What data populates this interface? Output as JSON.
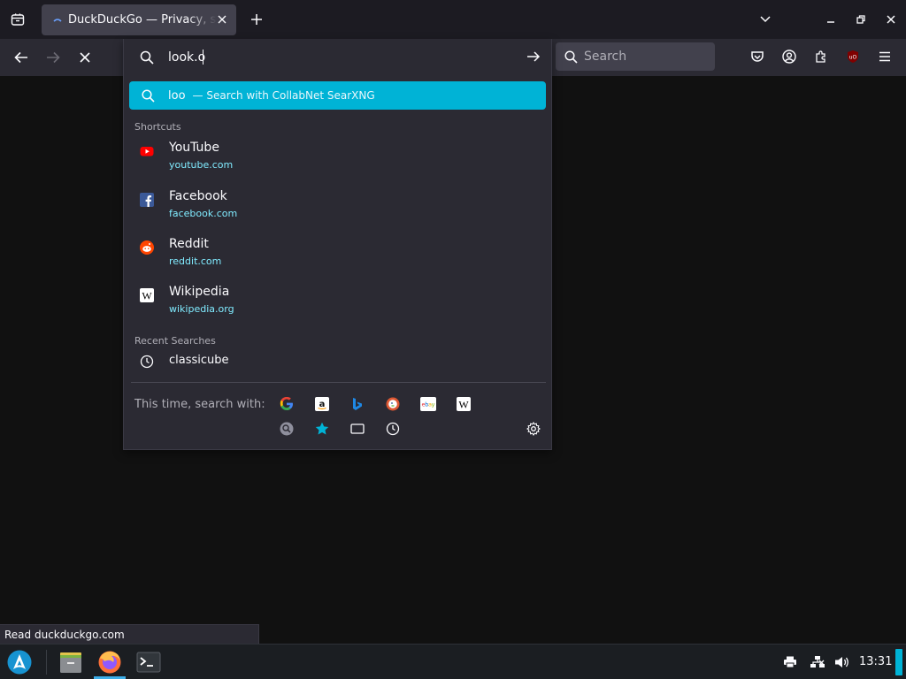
{
  "tabs": [
    {
      "title": "DuckDuckGo — Privacy, simplified.",
      "active": true
    }
  ],
  "urlbar": {
    "value": "look.o",
    "selected_suggestion": {
      "term": "loo",
      "action": "— Search with CollabNet SearXNG"
    }
  },
  "shortcuts": {
    "label": "Shortcuts",
    "items": [
      {
        "name": "YouTube",
        "url": "youtube.com",
        "icon": "youtube-icon"
      },
      {
        "name": "Facebook",
        "url": "facebook.com",
        "icon": "facebook-icon"
      },
      {
        "name": "Reddit",
        "url": "reddit.com",
        "icon": "reddit-icon"
      },
      {
        "name": "Wikipedia",
        "url": "wikipedia.org",
        "icon": "wikipedia-icon"
      }
    ]
  },
  "recent": {
    "label": "Recent Searches",
    "items": [
      {
        "text": "classicube",
        "icon": "clock-icon"
      }
    ]
  },
  "oneoff": {
    "label": "This time, search with:",
    "engines": [
      "google-icon",
      "amazon-icon",
      "bing-icon",
      "duckduckgo-icon",
      "ebay-icon",
      "wikipedia-icon"
    ],
    "modes": [
      "search-engine-icon",
      "bookmarks-star-icon",
      "tabs-icon",
      "history-clock-icon"
    ],
    "settings": "gear-icon"
  },
  "searchbar": {
    "placeholder": "Search"
  },
  "statusbar": {
    "text": "Read duckduckgo.com"
  },
  "taskbar": {
    "clock": "13:31"
  },
  "colors": {
    "accent": "#00b3d6",
    "link": "#80ebff",
    "panel": "#2b2a33",
    "page": "#111111"
  }
}
